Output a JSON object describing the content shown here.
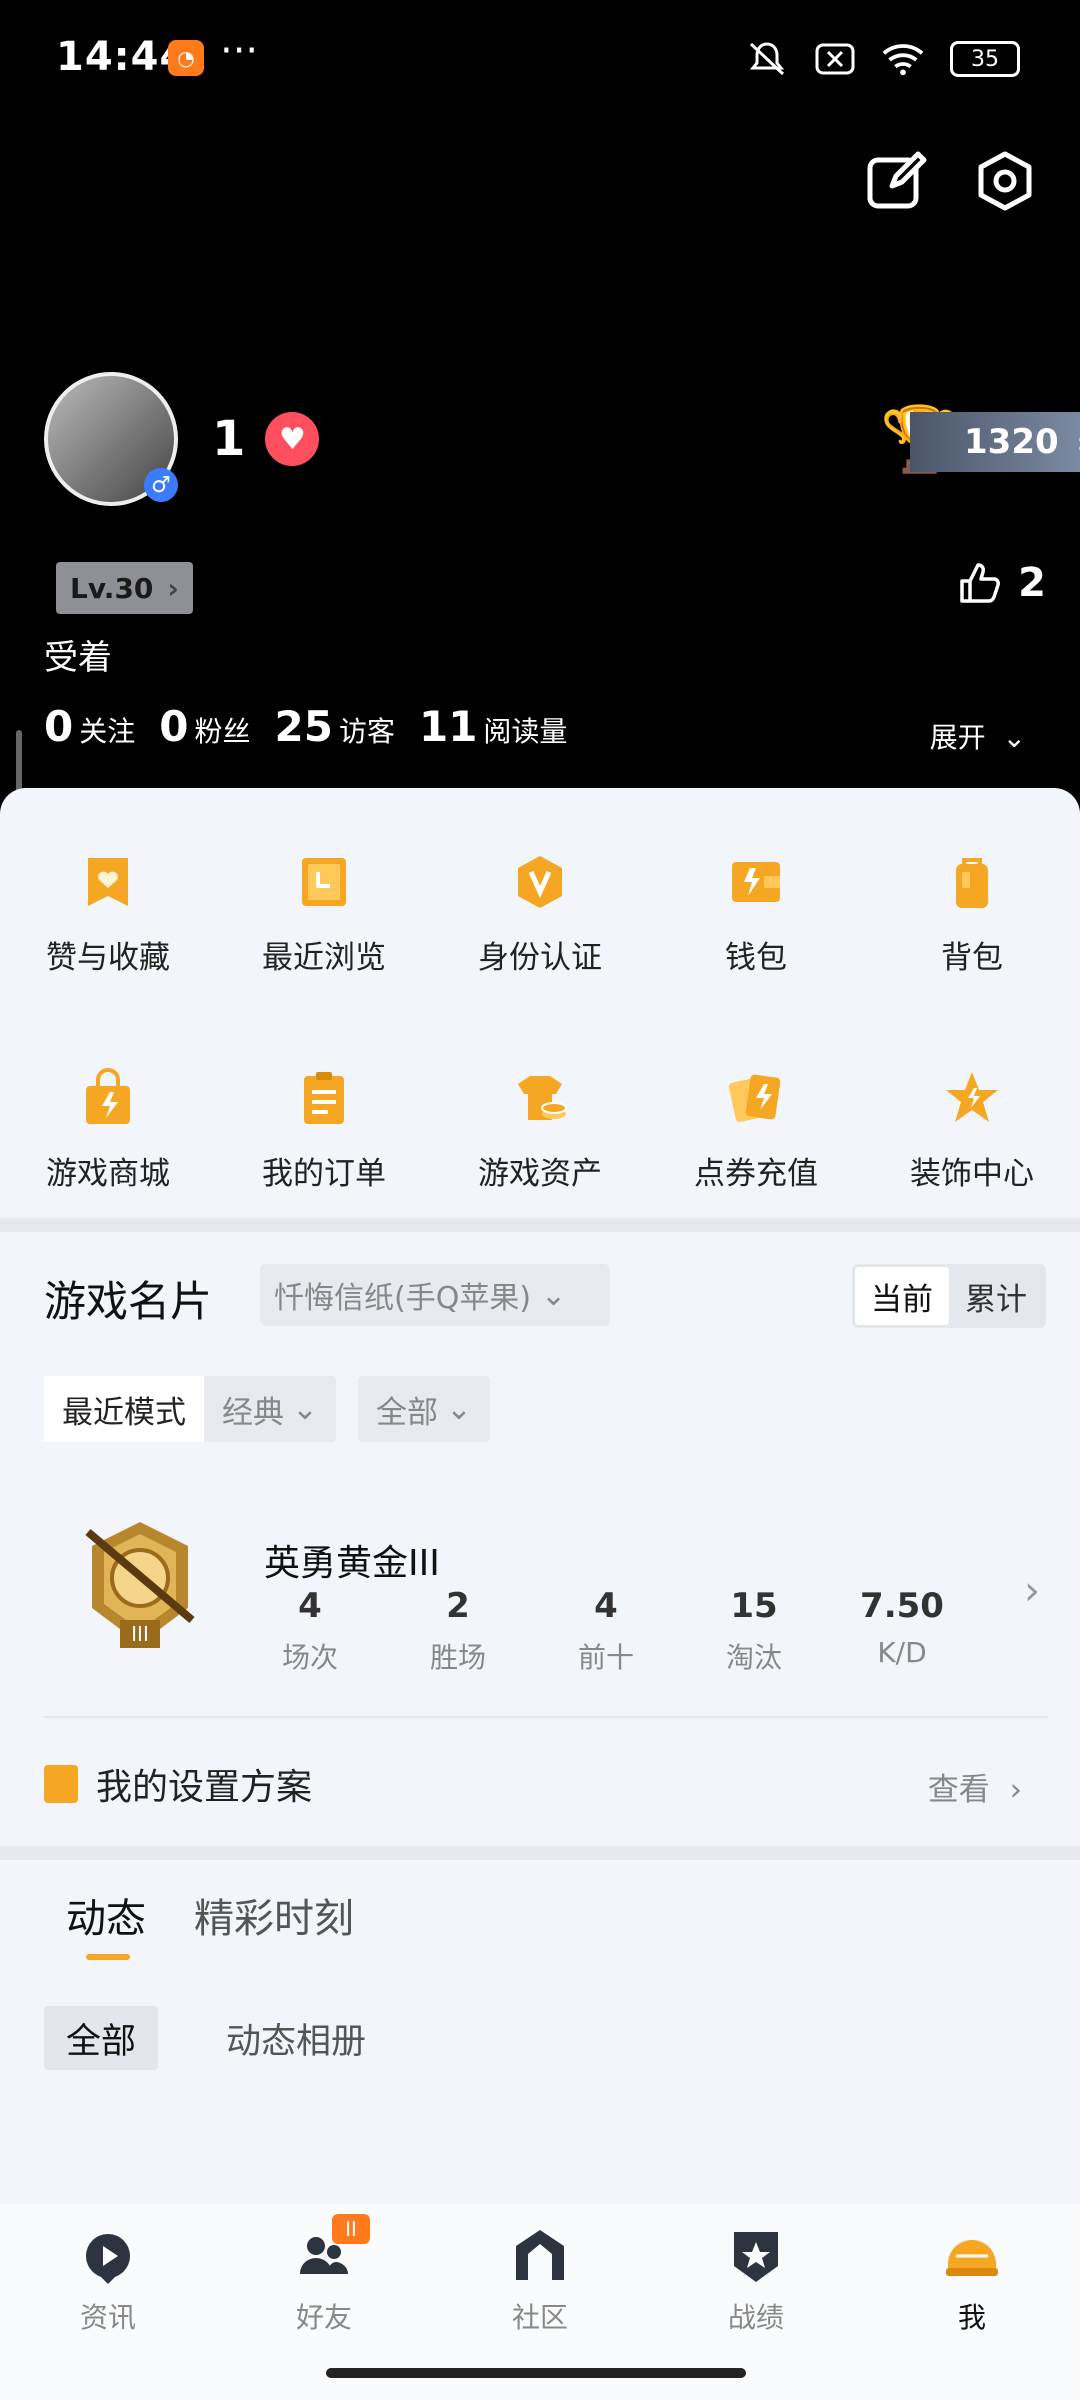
{
  "status_bar": {
    "time": "14:44",
    "dots": "···",
    "battery": "35"
  },
  "profile": {
    "likes_count": "1",
    "trophy_score": "1320",
    "level": "Lv.30",
    "praise_count": "2",
    "nickname": "受着",
    "stats": [
      {
        "value": "0",
        "label": "关注"
      },
      {
        "value": "0",
        "label": "粉丝"
      },
      {
        "value": "25",
        "label": "访客"
      },
      {
        "value": "11",
        "label": "阅读量"
      }
    ],
    "expand_label": "展开"
  },
  "menu": [
    {
      "label": "赞与收藏",
      "icon": "heart-bookmark-icon"
    },
    {
      "label": "最近浏览",
      "icon": "recent-browse-icon"
    },
    {
      "label": "身份认证",
      "icon": "verify-badge-icon"
    },
    {
      "label": "钱包",
      "icon": "wallet-icon"
    },
    {
      "label": "背包",
      "icon": "backpack-icon"
    },
    {
      "label": "游戏商城",
      "icon": "shopping-bag-icon"
    },
    {
      "label": "我的订单",
      "icon": "order-list-icon"
    },
    {
      "label": "游戏资产",
      "icon": "game-assets-icon"
    },
    {
      "label": "点券充值",
      "icon": "coupon-recharge-icon"
    },
    {
      "label": "装饰中心",
      "icon": "decoration-star-icon"
    }
  ],
  "game_card": {
    "title": "游戏名片",
    "account": "忏悔信纸(手Q苹果)",
    "segments": [
      "当前",
      "累计"
    ],
    "mode_filter": {
      "selected": "最近模式",
      "mode": "经典"
    },
    "scope_filter": "全部",
    "rank_name": "英勇黄金III",
    "rank_stats": [
      {
        "value": "4",
        "label": "场次"
      },
      {
        "value": "2",
        "label": "胜场"
      },
      {
        "value": "4",
        "label": "前十"
      },
      {
        "value": "15",
        "label": "淘汰"
      },
      {
        "value": "7.50",
        "label": "K/D"
      }
    ],
    "settings_plan": "我的设置方案",
    "view_label": "查看"
  },
  "feed": {
    "tabs": [
      "动态",
      "精彩时刻"
    ],
    "subtabs": [
      "全部",
      "动态相册"
    ]
  },
  "bottom_nav": [
    {
      "label": "资讯",
      "icon": "news-icon"
    },
    {
      "label": "好友",
      "icon": "friends-icon",
      "badge": "II"
    },
    {
      "label": "社区",
      "icon": "community-icon"
    },
    {
      "label": "战绩",
      "icon": "record-icon"
    },
    {
      "label": "我",
      "icon": "me-helmet-icon"
    }
  ],
  "colors": {
    "accent": "#f5a623",
    "heart": "#ff4f5e",
    "background_top": "#000000",
    "panel": "#f2f5f9"
  }
}
